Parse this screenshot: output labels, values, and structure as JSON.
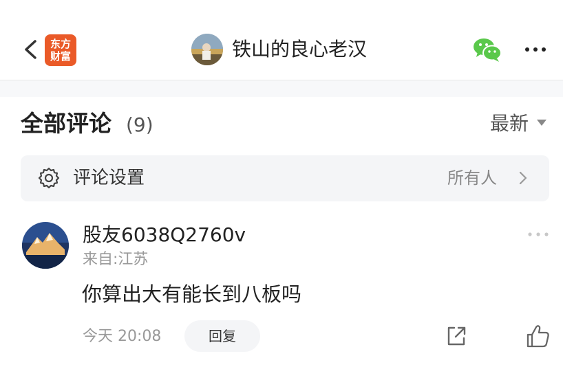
{
  "header": {
    "logo_line1": "东方",
    "logo_line2": "财富",
    "title": "铁山的良心老汉",
    "icons": [
      "back-icon",
      "wechat-icon",
      "more-icon"
    ]
  },
  "comments_section": {
    "title": "全部评论",
    "count": "(9)",
    "sort_label": "最新"
  },
  "settings": {
    "label": "评论设置",
    "value": "所有人"
  },
  "comment": {
    "user": "股友6038Q2760v",
    "location": "来自:江苏",
    "text": "你算出大有能长到八板吗",
    "time": "今天 20:08",
    "reply_label": "回复"
  },
  "colors": {
    "brand": "#ea5a28",
    "wechat": "#5ac84b",
    "panel_bg": "#f4f5f7",
    "muted_text": "#999999"
  }
}
